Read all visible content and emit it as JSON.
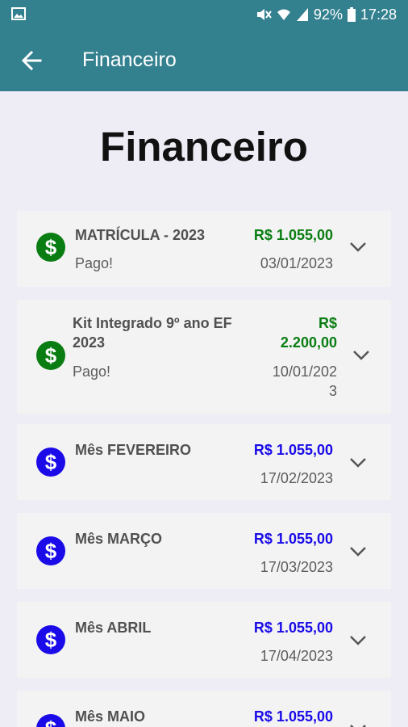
{
  "status_bar": {
    "battery": "92%",
    "time": "17:28",
    "icons": [
      "gallery-icon",
      "mute-icon",
      "wifi-icon",
      "signal-icon",
      "battery-icon"
    ]
  },
  "app_bar": {
    "title": "Financeiro",
    "back_icon": "arrow-left-icon"
  },
  "page": {
    "heading": "Financeiro"
  },
  "colors": {
    "app_bar": "#33808f",
    "paid": "#0a7d12",
    "pending": "#1a0be8",
    "background": "#eeedf6",
    "card": "#f3f3f3"
  },
  "items": [
    {
      "description": "MATRÍCULA - 2023",
      "status": "Pago!",
      "amount": "R$ 1.055,00",
      "date": "03/01/2023",
      "state": "paid",
      "icon": "dollar-icon"
    },
    {
      "description_lines": [
        "Kit Integrado 9º ano EF",
        "2023"
      ],
      "status": "Pago!",
      "amount_lines": [
        "R$",
        "2.200,00"
      ],
      "date_lines": [
        "10/01/202",
        "3"
      ],
      "state": "paid",
      "icon": "dollar-icon"
    },
    {
      "description": "Mês FEVEREIRO",
      "status": "",
      "amount": "R$ 1.055,00",
      "date": "17/02/2023",
      "state": "pending",
      "icon": "dollar-icon"
    },
    {
      "description": "Mês MARÇO",
      "status": "",
      "amount": "R$ 1.055,00",
      "date": "17/03/2023",
      "state": "pending",
      "icon": "dollar-icon"
    },
    {
      "description": "Mês ABRIL",
      "status": "",
      "amount": "R$ 1.055,00",
      "date": "17/04/2023",
      "state": "pending",
      "icon": "dollar-icon"
    },
    {
      "description": "Mês MAIO",
      "status": "",
      "amount": "R$ 1.055,00",
      "date": "",
      "state": "pending",
      "icon": "dollar-icon"
    }
  ]
}
